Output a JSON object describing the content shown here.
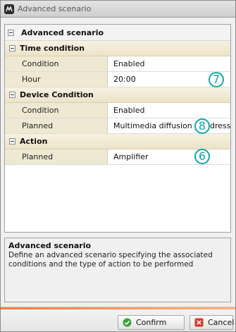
{
  "window": {
    "title": "Advanced scenario"
  },
  "tree": {
    "root_label": "Advanced scenario",
    "sections": [
      {
        "label": "Time condition",
        "rows": [
          {
            "label": "Condition",
            "value": "Enabled"
          },
          {
            "label": "Hour",
            "value": "20:00"
          }
        ]
      },
      {
        "label": "Device Condition",
        "rows": [
          {
            "label": "Condition",
            "value": "Enabled"
          },
          {
            "label": "Planned",
            "value": "Multimedia diffusion - Address"
          }
        ]
      },
      {
        "label": "Action",
        "rows": [
          {
            "label": "Planned",
            "value": "Amplifier"
          }
        ]
      }
    ]
  },
  "callouts": [
    "7",
    "8",
    "6"
  ],
  "description": {
    "title": "Advanced scenario",
    "text": "Define an advanced scenario specifying the associated conditions and the type of action to be performed"
  },
  "buttons": {
    "confirm": "Confirm",
    "cancel": "Cancel"
  },
  "colors": {
    "callout": "#16a7a6",
    "section_bg": "#efe8d2",
    "accent": "#ff7a3c"
  }
}
